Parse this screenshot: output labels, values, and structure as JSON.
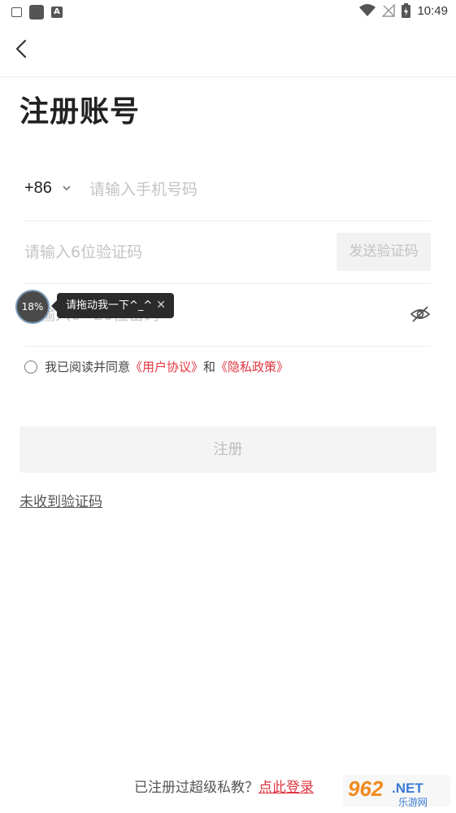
{
  "status_bar": {
    "time": "10:49",
    "left_icons": [
      "sim-card-icon",
      "app-square-icon",
      "font-a-icon"
    ],
    "right_icons": [
      "wifi-icon",
      "no-signal-icon",
      "battery-charging-icon"
    ]
  },
  "page": {
    "title": "注册账号"
  },
  "form": {
    "country_code": "+86",
    "phone_placeholder": "请输入手机号码",
    "code_placeholder": "请输入6位验证码",
    "send_code_label": "发送验证码",
    "password_placeholder": "请输入6~20位密码"
  },
  "floating_widget": {
    "percent": "18%",
    "tip_text": "请拖动我一下^_^",
    "close_glyph": "✕"
  },
  "agreement": {
    "prefix": "我已阅读并同意",
    "user_agreement": "《用户协议》",
    "and": "和",
    "privacy_policy": "《隐私政策》"
  },
  "register_label": "注册",
  "no_code_link": "未收到验证码",
  "footer": {
    "question": "已注册过超级私教？",
    "login_link": "点此登录"
  },
  "watermark": {
    "brand": "962.NET",
    "sub": "乐游网"
  },
  "colors": {
    "accent": "#e0353f",
    "placeholder": "#c4c4c4",
    "disabled_bg": "#f4f4f4"
  }
}
